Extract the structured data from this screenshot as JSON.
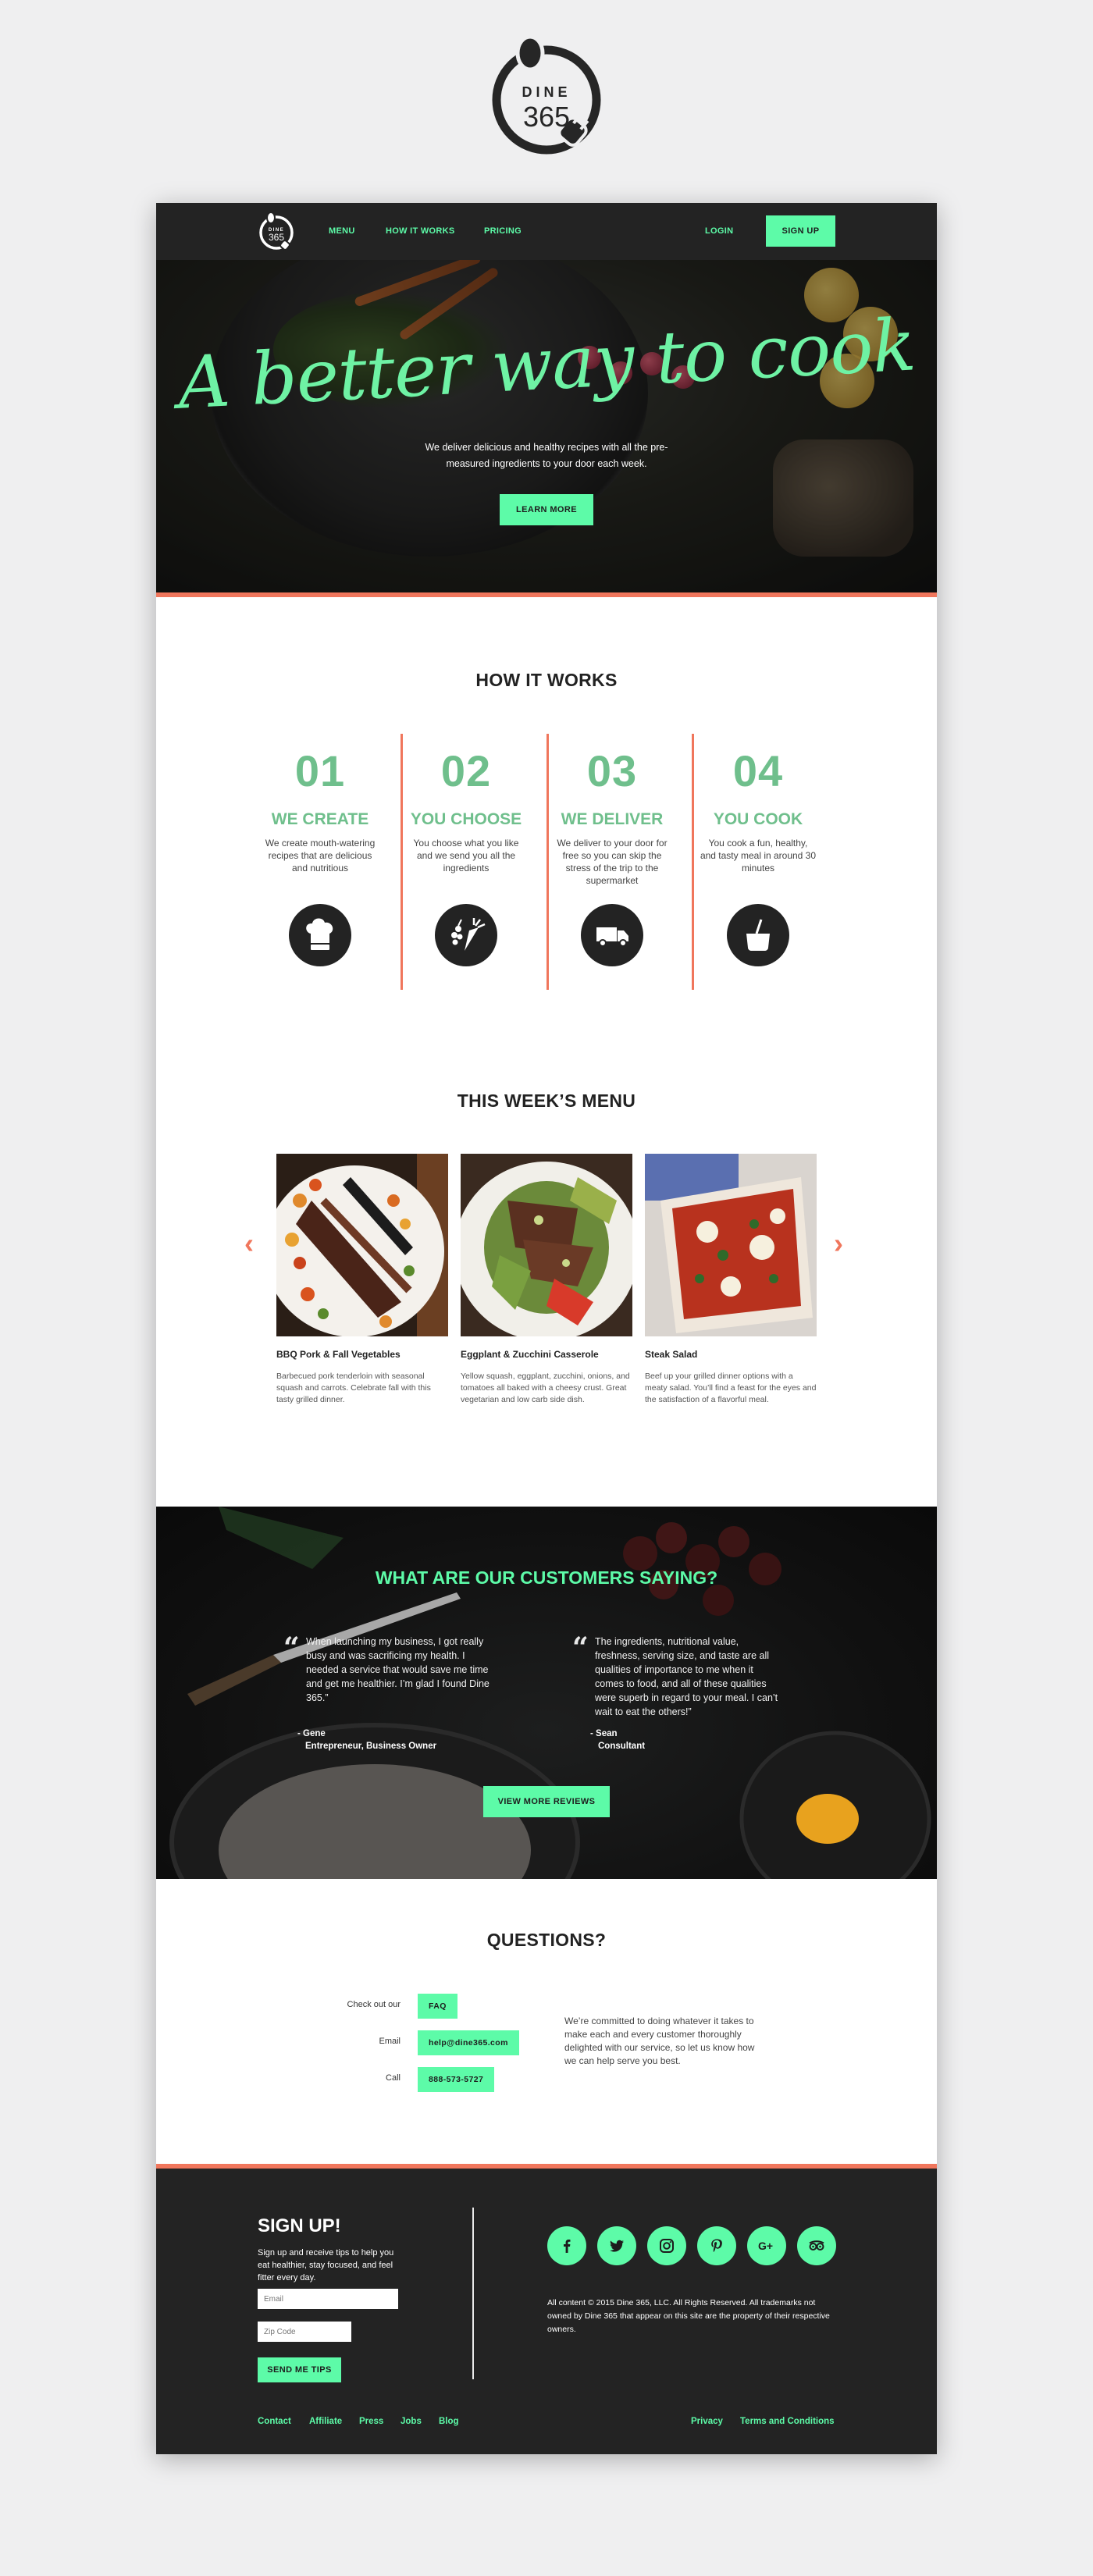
{
  "brand": {
    "logo_line1": "DINE",
    "logo_line2": "365"
  },
  "colors": {
    "accent_green": "#5dfba8",
    "dark_green": "#6fbf8c",
    "coral": "#f0765c",
    "dark": "#232323"
  },
  "nav": {
    "items": [
      {
        "label": "MENU"
      },
      {
        "label": "HOW IT WORKS"
      },
      {
        "label": "PRICING"
      }
    ],
    "login": "LOGIN",
    "signup": "SIGN UP"
  },
  "hero": {
    "title": "A better way to cook",
    "subtitle": "We deliver delicious and healthy recipes with all the pre-measured ingredients to your door each week.",
    "button": "LEARN MORE"
  },
  "how_it_works": {
    "title": "HOW IT WORKS",
    "steps": [
      {
        "number": "01",
        "title": "WE CREATE",
        "description": "We create mouth-watering recipes that are delicious and nutritious",
        "icon": "chef-hat-icon"
      },
      {
        "number": "02",
        "title": "YOU CHOOSE",
        "description": "You choose what you like and we send you all the ingredients",
        "icon": "vegetables-icon"
      },
      {
        "number": "03",
        "title": "WE DELIVER",
        "description": "We deliver to your door for free so you can skip the stress of the trip to the supermarket",
        "icon": "delivery-truck-icon"
      },
      {
        "number": "04",
        "title": "YOU COOK",
        "description": "You cook a fun, healthy, and tasty meal in around 30 minutes",
        "icon": "cooking-pot-icon"
      }
    ]
  },
  "menu": {
    "title": "THIS WEEK’S MENU",
    "prev_icon": "chevron-left-icon",
    "next_icon": "chevron-right-icon",
    "items": [
      {
        "name": "BBQ Pork & Fall Vegetables",
        "description": "Barbecued pork tenderloin with seasonal squash and carrots. Celebrate fall with this tasty grilled dinner."
      },
      {
        "name": "Eggplant & Zucchini Casserole",
        "description": "Yellow squash, eggplant, zucchini, onions, and tomatoes all baked with a cheesy crust. Great vegetarian and low carb side dish."
      },
      {
        "name": "Steak Salad",
        "description": "Beef up your grilled dinner options with a meaty salad. You’ll find a feast for the eyes and the satisfaction of a flavorful meal."
      }
    ]
  },
  "testimonials": {
    "title": "WHAT ARE OUR CUSTOMERS SAYING?",
    "quotes": [
      {
        "text": "When launching my business, I got really busy and was sacrificing my health. I needed a service that would save me time and get me healthier. I’m glad I found Dine 365.”",
        "author": "Gene",
        "role": "Entrepreneur, Business Owner"
      },
      {
        "text": "The ingredients, nutritional value, freshness, serving size, and taste are all qualities of importance to me when it comes to food, and all of these qualities were superb in regard to your meal. I can’t wait to eat the others!”",
        "author": "Sean",
        "role": "Consultant"
      }
    ],
    "button": "VIEW MORE REVIEWS"
  },
  "questions": {
    "title": "QUESTIONS?",
    "rows": [
      {
        "label": "Check out our",
        "value": "FAQ"
      },
      {
        "label": "Email",
        "value": "help@dine365.com"
      },
      {
        "label": "Call",
        "value": "888-573-5727"
      }
    ],
    "text": "We’re committed to doing whatever it takes to make each and every customer thoroughly delighted with our service, so let us know how we can help serve you best."
  },
  "footer": {
    "signup_title": "SIGN UP!",
    "signup_text": "Sign up and receive tips to help you eat healthier, stay focused, and feel fitter every day.",
    "email_placeholder": "Email",
    "zip_placeholder": "Zip Code",
    "signup_button": "SEND ME TIPS",
    "social": [
      "facebook-icon",
      "twitter-icon",
      "instagram-icon",
      "pinterest-icon",
      "google-plus-icon",
      "tripadvisor-icon"
    ],
    "legal": "All content © 2015 Dine 365, LLC. All Rights Reserved. All trademarks not owned by Dine 365 that appear on this site are the property of their respective owners.",
    "links_left": [
      "Contact",
      "Affiliate",
      "Press",
      "Jobs",
      "Blog"
    ],
    "links_right": [
      "Privacy",
      "Terms and Conditions"
    ]
  }
}
